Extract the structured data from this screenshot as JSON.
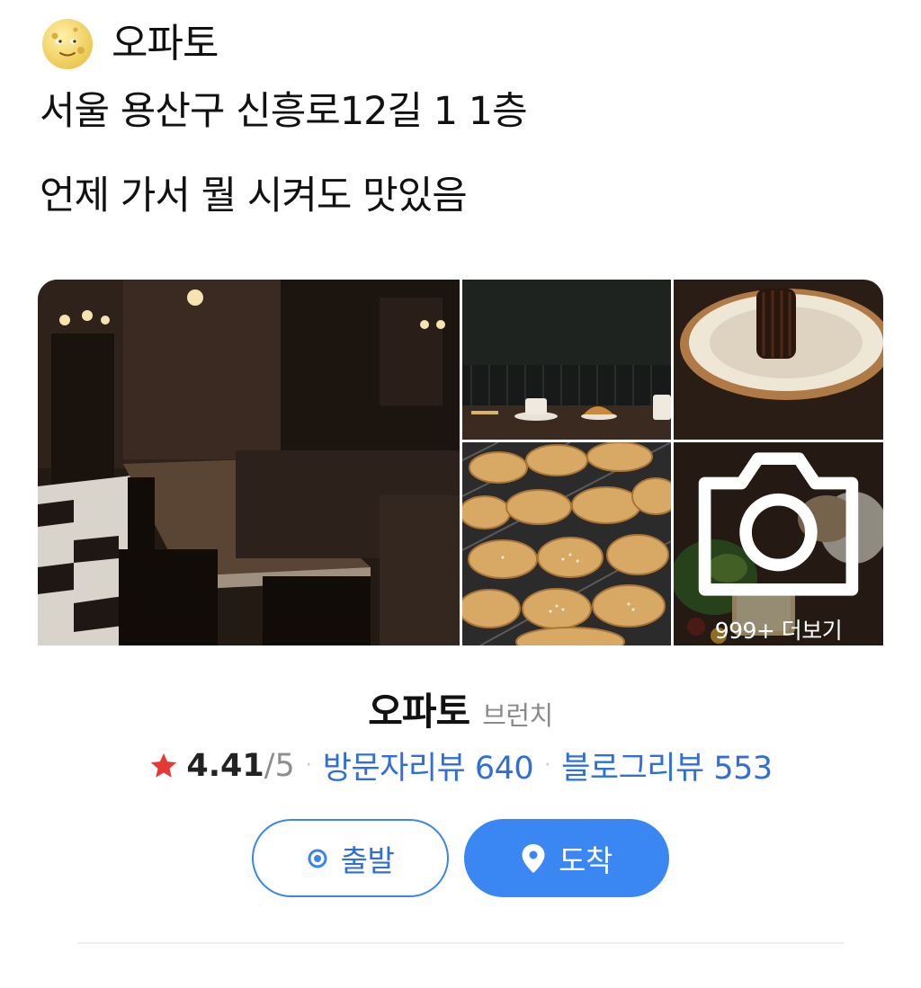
{
  "tweet": {
    "author_icon": "full-moon-face-icon",
    "author_name": "오파토",
    "address_line": "서울 용산구 신흥로12길 1 1층",
    "comment_line": "언제 가서 뭘 시켜도 맛있음"
  },
  "place_card": {
    "more_photos_label": "999+ 더보기",
    "name": "오파토",
    "category": "브런치",
    "rating": "4.41",
    "rating_max": "/5",
    "separator": "·",
    "visitor_reviews": "방문자리뷰 640",
    "blog_reviews": "블로그리뷰 553",
    "depart_label": "출발",
    "arrive_label": "도착",
    "colors": {
      "accent": "#3a86f2",
      "link": "#2f6fd6",
      "star": "#e53935"
    }
  }
}
